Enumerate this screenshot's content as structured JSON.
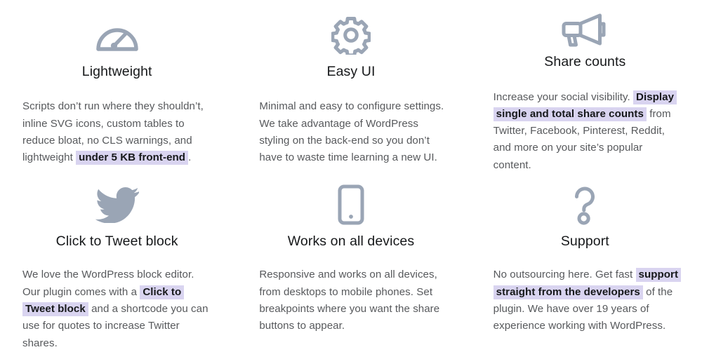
{
  "theme": {
    "background": "#ffffff",
    "icon_color": "#9aa5b5",
    "heading_color": "#16181a",
    "body_color": "#57595c",
    "highlight_background": "#d9d4f0",
    "highlight_text_color": "#16181a"
  },
  "features": [
    {
      "icon": "speedometer-icon",
      "title": "Lightweight",
      "body": [
        {
          "text": "Scripts don’t run where they shouldn’t, inline SVG icons, custom tables to reduce bloat, no CLS warnings, and lightweight ",
          "highlight": false
        },
        {
          "text": "under 5 KB front-end",
          "highlight": true
        },
        {
          "text": ".",
          "highlight": false
        }
      ]
    },
    {
      "icon": "gear-icon",
      "title": "Easy UI",
      "body": [
        {
          "text": "Minimal and easy to configure settings. We take advantage of WordPress styling on the back-end so you don’t have to waste time learning a new UI.",
          "highlight": false
        }
      ]
    },
    {
      "icon": "megaphone-icon",
      "title": "Share counts",
      "body": [
        {
          "text": "Increase your social visibility. ",
          "highlight": false
        },
        {
          "text": "Display single and total share counts",
          "highlight": true
        },
        {
          "text": " from Twitter, Facebook, Pinterest, Reddit, and more on your site’s popular content.",
          "highlight": false
        }
      ]
    },
    {
      "icon": "twitter-bird-icon",
      "title": "Click to Tweet block",
      "body": [
        {
          "text": "We love the WordPress block editor. Our plugin comes with a ",
          "highlight": false
        },
        {
          "text": "Click to Tweet block",
          "highlight": true
        },
        {
          "text": " and a shortcode you can use for quotes to increase Twitter shares.",
          "highlight": false
        }
      ]
    },
    {
      "icon": "mobile-phone-icon",
      "title": "Works on all devices",
      "body": [
        {
          "text": "Responsive and works on all devices, from desktops to mobile phones. Set breakpoints where you want the share buttons to appear.",
          "highlight": false
        }
      ]
    },
    {
      "icon": "question-mark-icon",
      "title": "Support",
      "body": [
        {
          "text": "No outsourcing here. Get fast ",
          "highlight": false
        },
        {
          "text": "support straight from the developers",
          "highlight": true
        },
        {
          "text": " of the plugin. We have over 19 years of experience working with WordPress.",
          "highlight": false
        }
      ]
    }
  ]
}
